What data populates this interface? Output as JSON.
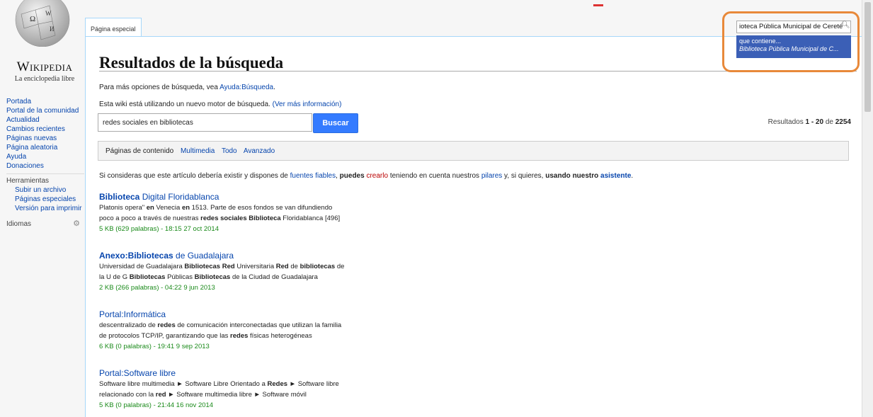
{
  "logo": {
    "wordmark": "Wikipedia",
    "tagline": "La enciclopedia libre"
  },
  "sidebar": {
    "nav": [
      "Portada",
      "Portal de la comunidad",
      "Actualidad",
      "Cambios recientes",
      "Páginas nuevas",
      "Página aleatoria",
      "Ayuda",
      "Donaciones"
    ],
    "tools_title": "Herramientas",
    "tools": [
      "Subir un archivo",
      "Páginas especiales",
      "Versión para imprimir"
    ],
    "languages_title": "Idiomas"
  },
  "tab": {
    "label": "Página especial"
  },
  "header_search": {
    "value": "ioteca Pública Municipal de Cereté",
    "suggestion_line1": "que contiene...",
    "suggestion_line2": "Biblioteca Pública Municipal de C..."
  },
  "page": {
    "title": "Resultados de la búsqueda",
    "help_prefix": "Para más opciones de búsqueda, vea ",
    "help_link": "Ayuda:Búsqueda",
    "help_suffix": ".",
    "engine_text": "Esta wiki está utilizando un nuevo motor de búsqueda. ",
    "engine_link": "(Ver más información)"
  },
  "search": {
    "query": "redes sociales en bibliotecas",
    "button": "Buscar",
    "results_prefix": "Resultados ",
    "results_range": "1 - 20",
    "results_of": " de ",
    "results_total": "2254"
  },
  "filters": {
    "current": "Páginas de contenido",
    "links": [
      "Multimedia",
      "Todo",
      "Avanzado"
    ]
  },
  "suggestion_notice": {
    "t1": "Si consideras que este artículo debería existir y dispones de ",
    "l1": "fuentes fiables",
    "t2": ", ",
    "b1": "puedes",
    "t3": " ",
    "red": "crearlo",
    "t4": " teniendo en cuenta nuestros ",
    "l2": "pilares",
    "t5": " y, si quieres, ",
    "b2": "usando nuestro",
    "t6": " ",
    "l3": "asistente",
    "t7": "."
  },
  "results": [
    {
      "title_bold": "Biblioteca",
      "title_rest": " Digital Floridablanca",
      "line1": "Platonis opera\" en Venecia en 1513. Parte de esos fondos se van difundiendo",
      "line2": "poco a poco a través de nuestras redes sociales Biblioteca Floridablanca [496]",
      "meta": "5 KB (629 palabras) - 18:15 27 oct 2014"
    },
    {
      "title_bold": "Anexo:Bibliotecas",
      "title_rest": " de Guadalajara",
      "line1": "Universidad de Guadalajara Bibliotecas Red Universitaria Red de bibliotecas de",
      "line2": "la U de G Bibliotecas Públicas Bibliotecas de la Ciudad de Guadalajara",
      "meta": "2 KB (266 palabras) - 04:22 9 jun 2013"
    },
    {
      "title_bold": "",
      "title_rest": "Portal:Informática",
      "line1": "descentralizado de redes de comunicación interconectadas que utilizan la familia",
      "line2": "de protocolos TCP/IP, garantizando que las redes físicas heterogéneas",
      "meta": "6 KB (0 palabras) - 19:41 9 sep 2013"
    },
    {
      "title_bold": "",
      "title_rest": "Portal:Software libre",
      "line1": "Software libre multimedia ► Software Libre Orientado a Redes ► Software libre",
      "line2": "relacionado con la red ► Software multimedia libre ► Software móvil",
      "meta": "5 KB (0 palabras) - 21:44 16 nov 2014"
    }
  ]
}
